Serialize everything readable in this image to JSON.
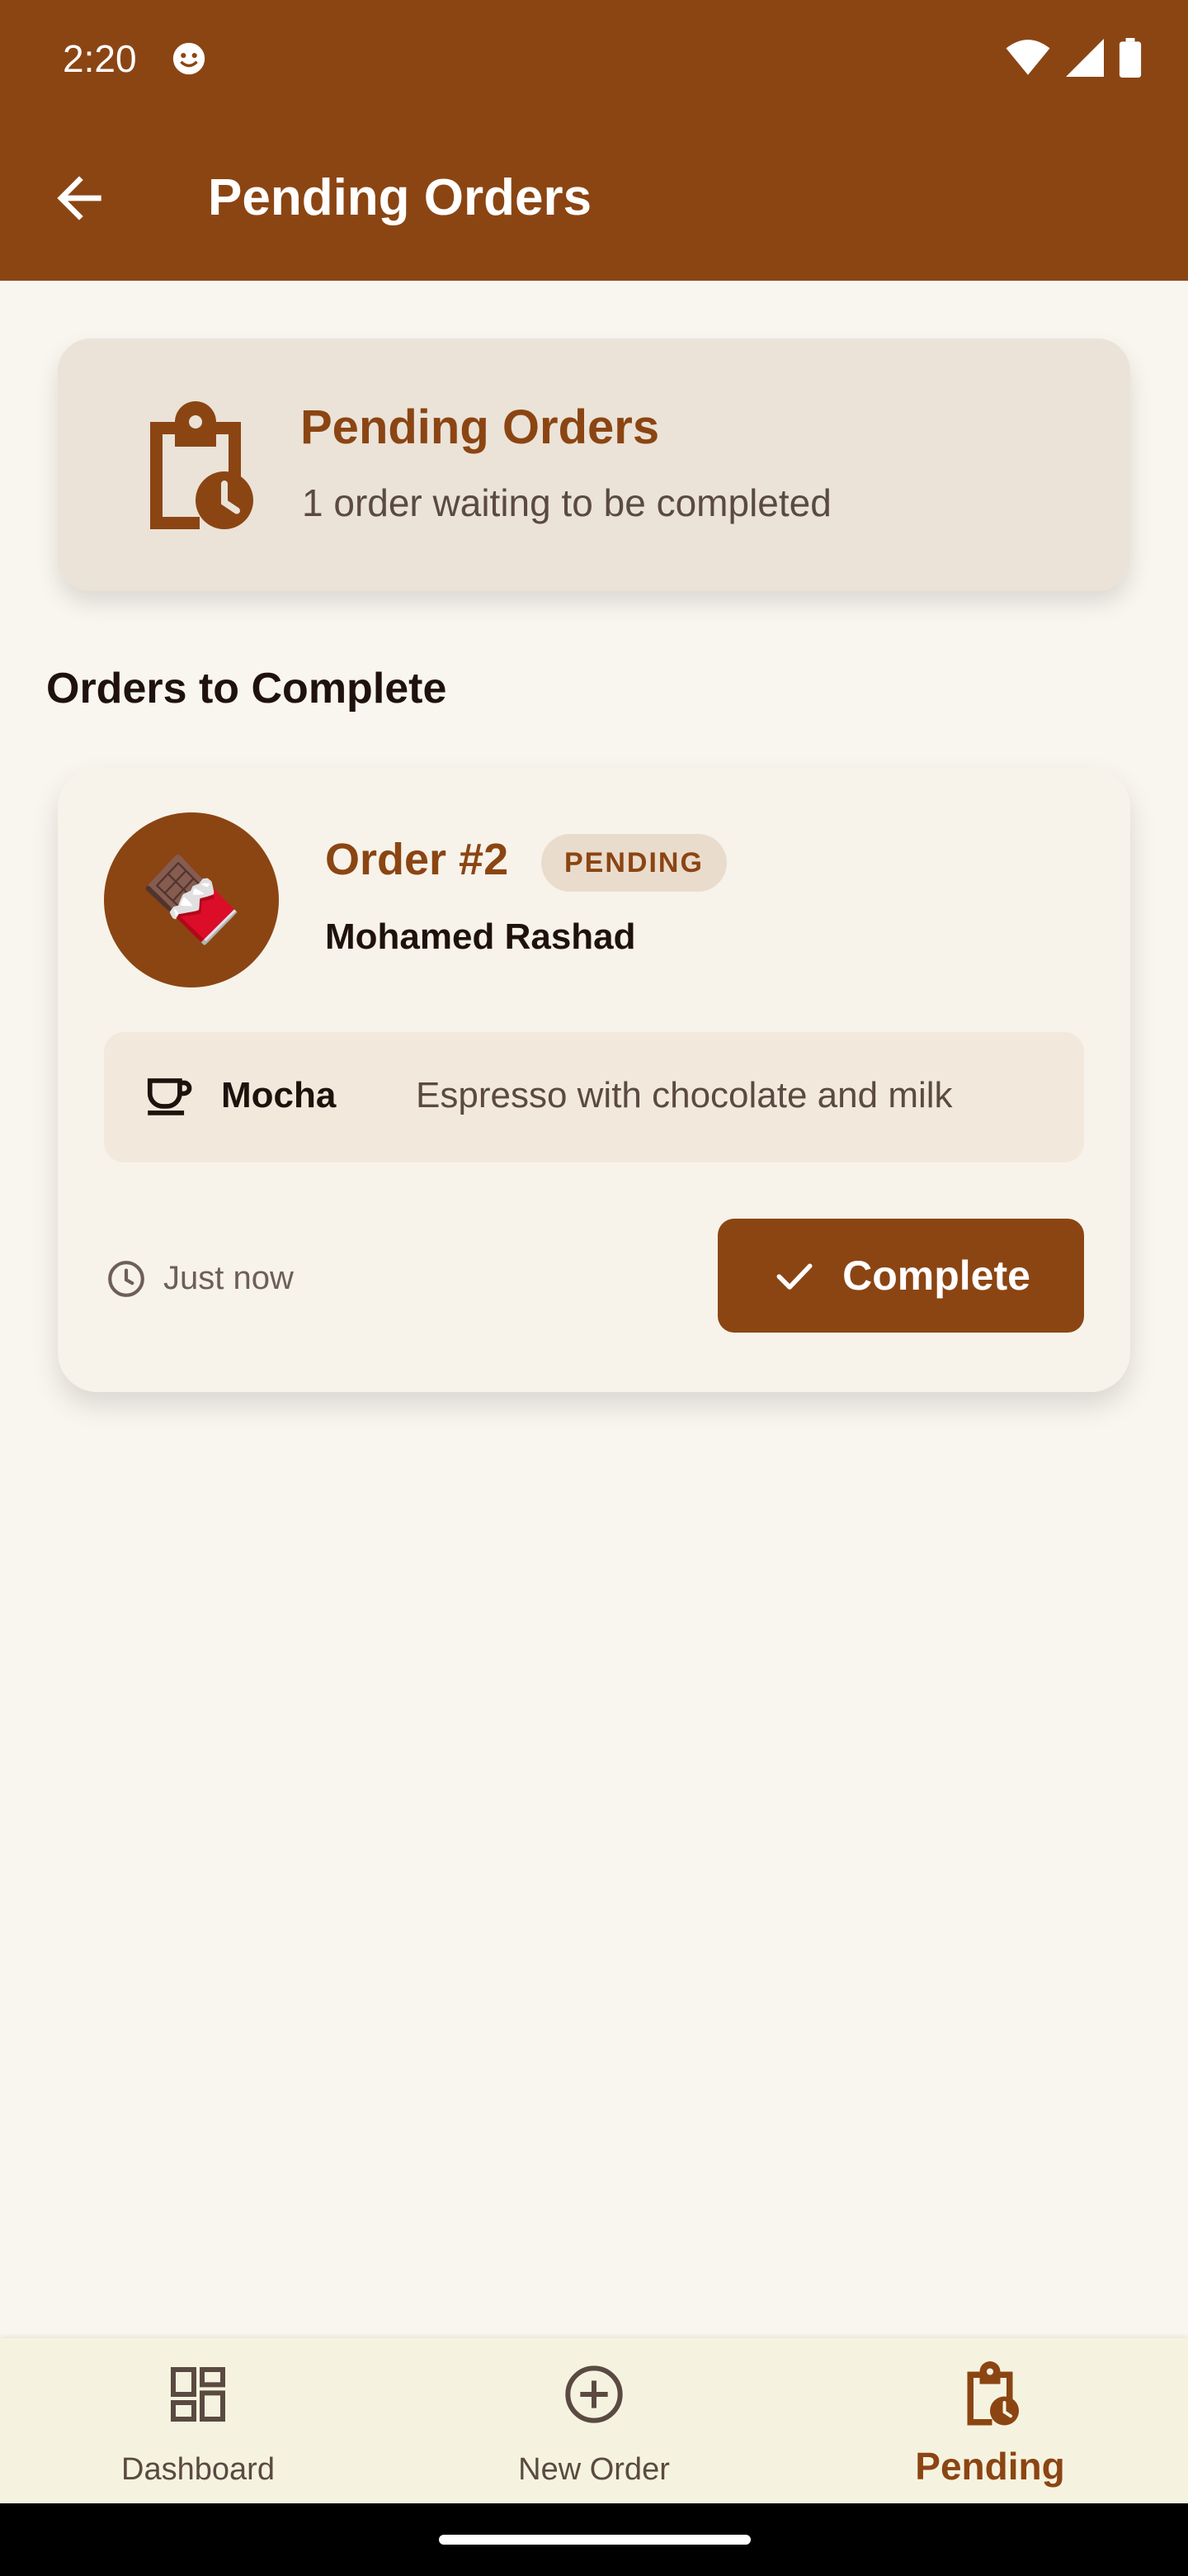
{
  "status_bar": {
    "time": "2:20"
  },
  "app_bar": {
    "title": "Pending Orders"
  },
  "summary": {
    "title": "Pending Orders",
    "subtitle": "1 order waiting to be completed"
  },
  "section": {
    "title": "Orders to Complete"
  },
  "order": {
    "number": "Order #2",
    "badge": "PENDING",
    "customer": "Mohamed Rashad",
    "avatar_emoji": "🍫",
    "item_name": "Mocha",
    "item_desc": "Espresso with chocolate and milk",
    "time": "Just now",
    "complete_label": "Complete"
  },
  "bottom_nav": {
    "items": [
      {
        "label": "Dashboard",
        "icon": "dashboard-icon",
        "active": false
      },
      {
        "label": "New Order",
        "icon": "add-circle-icon",
        "active": false
      },
      {
        "label": "Pending",
        "icon": "pending-clipboard-icon",
        "active": true
      }
    ]
  },
  "colors": {
    "primary": "#8b4513",
    "background": "#f9f6ef",
    "summary_card": "#ebe3d8",
    "badge_bg": "#eadccc",
    "nav_bg": "#f5f3df"
  }
}
